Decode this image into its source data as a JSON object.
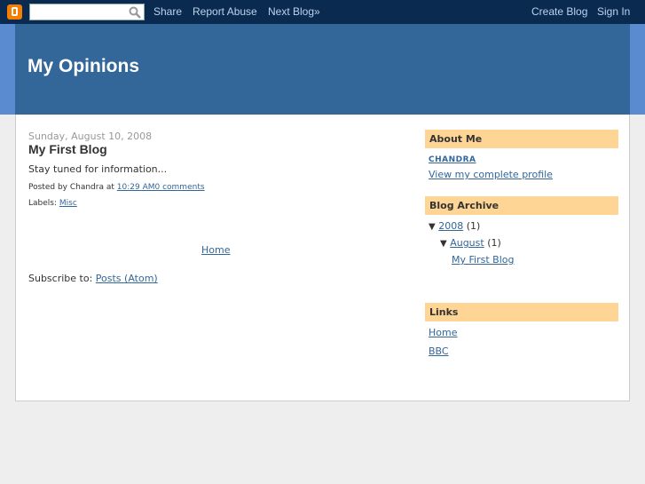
{
  "navbar": {
    "search_placeholder": "",
    "share": "Share",
    "report_abuse": "Report Abuse",
    "next_blog": "Next Blog»",
    "create_blog": "Create Blog",
    "sign_in": "Sign In"
  },
  "header": {
    "title": "My Opinions"
  },
  "post": {
    "date": "Sunday, August 10, 2008",
    "title": "My First Blog",
    "body": "Stay tuned for information...",
    "posted_by": "Posted by Chandra at",
    "time": "10:29 AM",
    "comments": "0 comments",
    "labels_prefix": "Labels:",
    "label": "Misc"
  },
  "main": {
    "home": "Home",
    "subscribe_prefix": "Subscribe to:",
    "subscribe_link": "Posts (Atom)"
  },
  "sidebar": {
    "about_title": "About Me",
    "author_name": "CHANDRA",
    "profile_link": "View my complete profile",
    "archive_title": "Blog Archive",
    "archive_toggle": "▼",
    "year": "2008",
    "year_count": "(1)",
    "month": "August",
    "month_count": "(1)",
    "archive_post": "My First Blog",
    "links_title": "Links",
    "links": [
      {
        "label": "Home"
      },
      {
        "label": "BBC"
      }
    ]
  },
  "colors": {
    "navbar": "#0a2a4f",
    "header_band": "#5a8ad0",
    "header": "#336699",
    "widget_title_bg": "#ffd595",
    "link": "#336699",
    "blogger_orange": "#f57d00"
  }
}
